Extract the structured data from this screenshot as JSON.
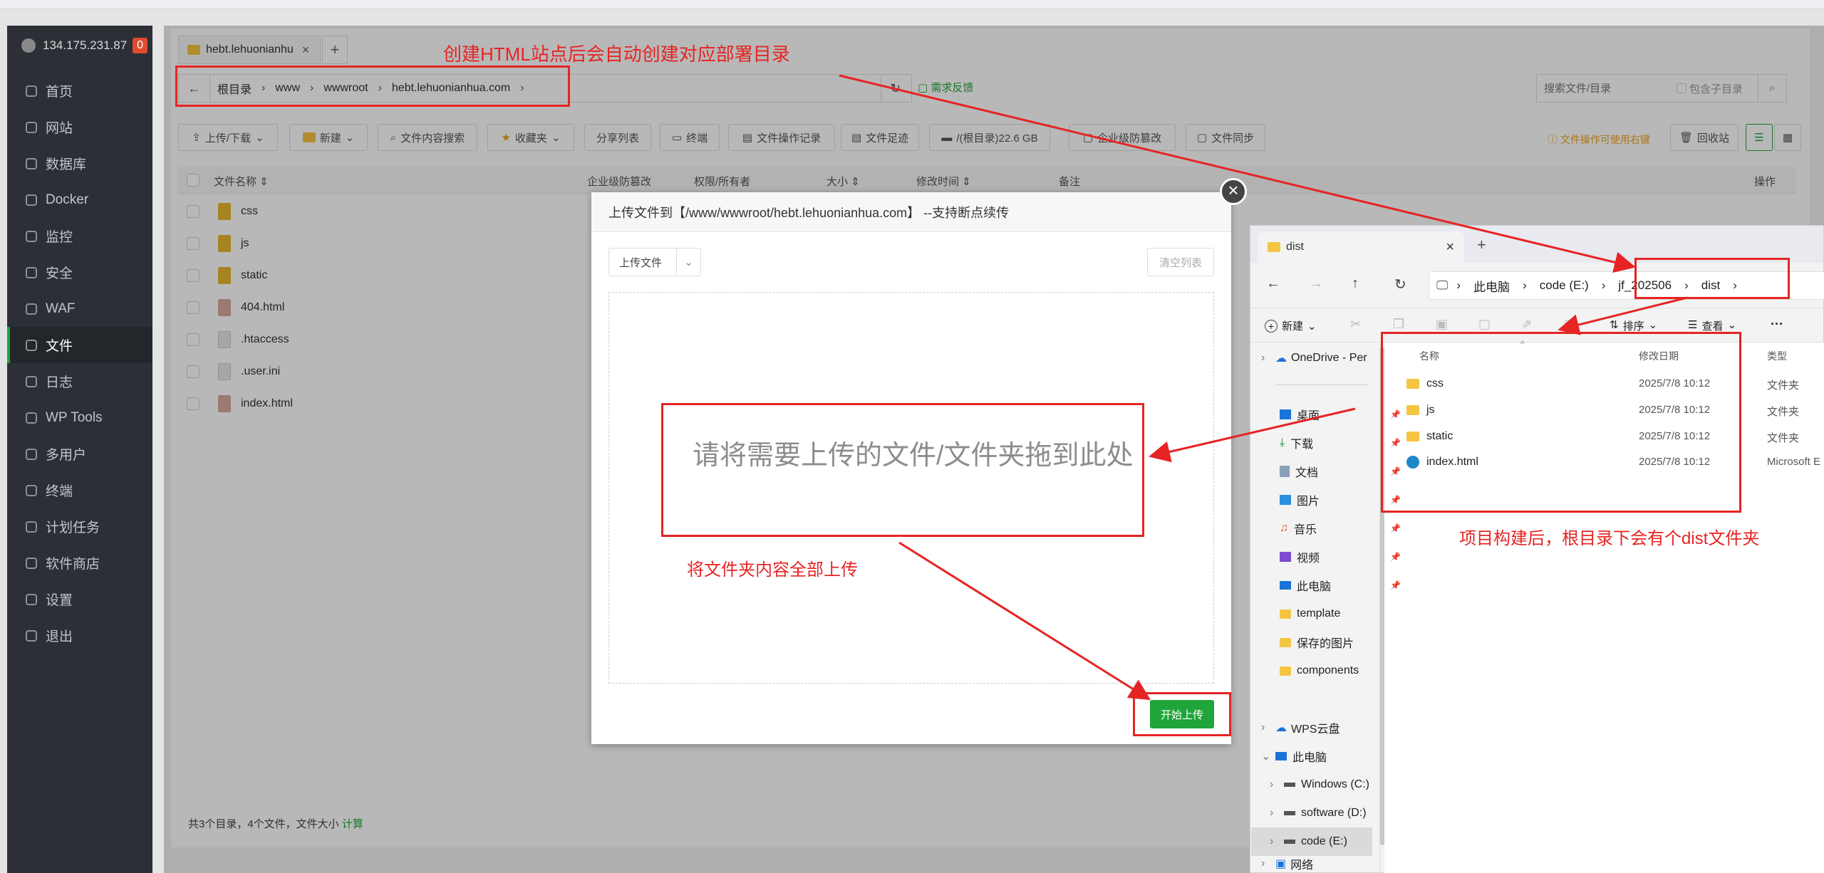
{
  "sidebar": {
    "ip": "134.175.231.87",
    "badge": "0",
    "items": [
      {
        "label": "首页"
      },
      {
        "label": "网站"
      },
      {
        "label": "数据库"
      },
      {
        "label": "Docker"
      },
      {
        "label": "监控"
      },
      {
        "label": "安全"
      },
      {
        "label": "WAF"
      },
      {
        "label": "文件"
      },
      {
        "label": "日志"
      },
      {
        "label": "WP Tools"
      },
      {
        "label": "多用户"
      },
      {
        "label": "终端"
      },
      {
        "label": "计划任务"
      },
      {
        "label": "软件商店"
      },
      {
        "label": "设置"
      },
      {
        "label": "退出"
      }
    ]
  },
  "filemgr": {
    "tab_label": "hebt.lehuonianhu",
    "add_tab": "+",
    "breadcrumb": [
      "根目录",
      "www",
      "wwwroot",
      "hebt.lehuonianhua.com"
    ],
    "feedback": "需求反馈",
    "search_placeholder": "搜索文件/目录",
    "include_sub": "包含子目录",
    "toolbar": {
      "upload": "上传/下载",
      "new": "新建",
      "content_search": "文件内容搜索",
      "favorites": "收藏夹",
      "share_list": "分享列表",
      "terminal": "终端",
      "op_log": "文件操作记录",
      "footprint": "文件足迹",
      "disk": "/(根目录)22.6 GB",
      "enterprise": "企业级防篡改",
      "sync": "文件同步",
      "tip": "文件操作可使用右键",
      "recycle": "回收站"
    },
    "columns": {
      "name": "文件名称",
      "tamper": "企业级防篡改",
      "perm": "权限/所有者",
      "size": "大小",
      "mtime": "修改时间",
      "note": "备注",
      "ops": "操作"
    },
    "rows": [
      {
        "name": "css",
        "type": "folder"
      },
      {
        "name": "js",
        "type": "folder"
      },
      {
        "name": "static",
        "type": "folder"
      },
      {
        "name": "404.html",
        "type": "html"
      },
      {
        "name": ".htaccess",
        "type": "file"
      },
      {
        "name": ".user.ini",
        "type": "file"
      },
      {
        "name": "index.html",
        "type": "html"
      }
    ],
    "footer": "共3个目录，4个文件，文件大小",
    "footer_link": "计算"
  },
  "modal": {
    "title": "上传文件到【/www/wwwroot/hebt.lehuonianhua.com】 --支持断点续传",
    "upload_btn": "上传文件",
    "clear_list": "清空列表",
    "drop_hint": "请将需要上传的文件/文件夹拖到此处",
    "start_upload": "开始上传",
    "close": "×"
  },
  "explorer": {
    "tab_title": "dist",
    "path": [
      "此电脑",
      "code (E:)",
      "jf_202506",
      "dist"
    ],
    "cmd": {
      "new": "新建",
      "sort": "排序",
      "view": "查看",
      "more": "···"
    },
    "nav": {
      "onedrive": "OneDrive - Per",
      "quick": [
        {
          "label": "桌面",
          "pin": true
        },
        {
          "label": "下载",
          "pin": true
        },
        {
          "label": "文档",
          "pin": true
        },
        {
          "label": "图片",
          "pin": true
        },
        {
          "label": "音乐",
          "pin": true
        },
        {
          "label": "视频",
          "pin": true
        },
        {
          "label": "此电脑",
          "pin": true
        },
        {
          "label": "template",
          "pin": false
        },
        {
          "label": "保存的图片",
          "pin": false
        },
        {
          "label": "components",
          "pin": false
        }
      ],
      "wps": "WPS云盘",
      "thispc": "此电脑",
      "drives": [
        "Windows (C:)",
        "software (D:)",
        "code (E:)"
      ],
      "network": "网络"
    },
    "columns": {
      "name": "名称",
      "date": "修改日期",
      "type": "类型"
    },
    "rows": [
      {
        "name": "css",
        "date": "2025/7/8 10:12",
        "type": "文件夹",
        "kind": "folder"
      },
      {
        "name": "js",
        "date": "2025/7/8 10:12",
        "type": "文件夹",
        "kind": "folder"
      },
      {
        "name": "static",
        "date": "2025/7/8 10:12",
        "type": "文件夹",
        "kind": "folder"
      },
      {
        "name": "index.html",
        "date": "2025/7/8 10:12",
        "type": "Microsoft E",
        "kind": "edge"
      }
    ]
  },
  "annotations": {
    "a1": "创建HTML站点后会自动创建对应部署目录",
    "a2": "将文件夹内容全部上传",
    "a3": "项目构建后，根目录下会有个dist文件夹"
  },
  "colors": {
    "accent_green": "#20a53a",
    "annotation_red": "#e62424",
    "sidebar_bg": "#2c3036"
  }
}
